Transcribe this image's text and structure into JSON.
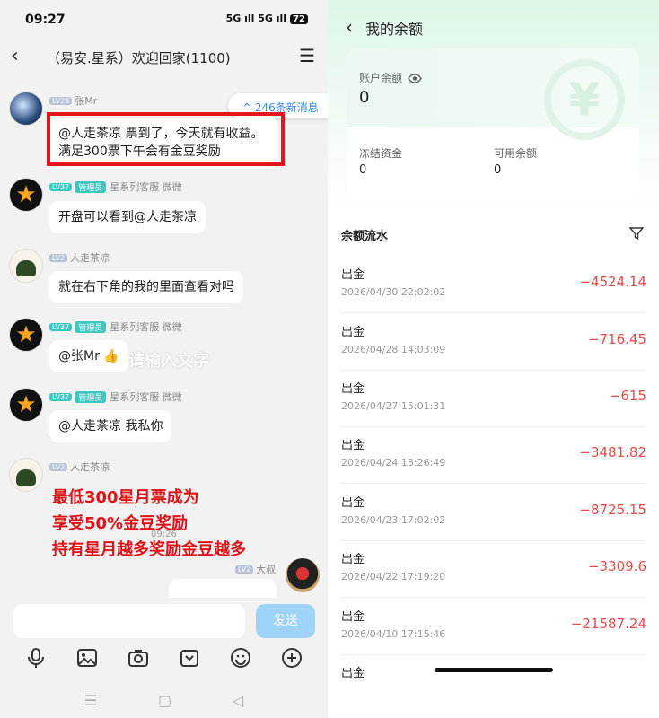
{
  "status_bar": {
    "time": "09:27",
    "signal": "5G ıll 5G ıll",
    "battery": "72"
  },
  "chat": {
    "title": "（易安.星系）欢迎回家(1100)",
    "new_messages": "^ 246条新消息",
    "messages": [
      {
        "level": "LV28",
        "sender": "张Mr",
        "text": "@人走茶凉 票到了，今天就有收益。满足300票下午会有金豆奖励"
      },
      {
        "level": "LV37",
        "role": "管理员",
        "sender": "星系列客服 微微",
        "text": "开盘可以看到@人走茶凉"
      },
      {
        "level": "LV2",
        "sender": "人走茶凉",
        "text": "就在右下角的我的里面查看对吗"
      },
      {
        "level": "LV37",
        "role": "管理员",
        "sender": "星系列客服 微微",
        "text": "@张Mr 👍"
      },
      {
        "level": "LV37",
        "role": "管理员",
        "sender": "星系列客服 微微",
        "text": "@人走茶凉 我私你"
      },
      {
        "level": "LV2",
        "sender": "人走茶凉"
      }
    ],
    "overlay_watermark": "请输入文字",
    "overlay_lines": [
      "最低300星月票成为",
      "享受50%金豆奖励",
      "持有星月越多奖励金豆越多"
    ],
    "timestamp": "09:26",
    "right_sender": {
      "level": "LV2",
      "sender": "大叔"
    },
    "send_label": "发送"
  },
  "balance": {
    "title": "我的余额",
    "account_label": "账户余额",
    "account_value": "0",
    "frozen_label": "冻结资金",
    "frozen_value": "0",
    "available_label": "可用余额",
    "available_value": "0",
    "flow_title": "余额流水",
    "rows": [
      {
        "type": "出金",
        "date": "2026/04/30 22:02:02",
        "amount": "−4524.14"
      },
      {
        "type": "出金",
        "date": "2026/04/28 14:03:09",
        "amount": "−716.45"
      },
      {
        "type": "出金",
        "date": "2026/04/27 15:01:31",
        "amount": "−615"
      },
      {
        "type": "出金",
        "date": "2026/04/24 18:26:49",
        "amount": "−3481.82"
      },
      {
        "type": "出金",
        "date": "2026/04/23 17:02:02",
        "amount": "−8725.15"
      },
      {
        "type": "出金",
        "date": "2026/04/22 17:19:20",
        "amount": "−3309.6"
      },
      {
        "type": "出金",
        "date": "2026/04/10 17:15:46",
        "amount": "−21587.24"
      },
      {
        "type": "出金"
      }
    ],
    "accent_color": "#e84a4a"
  }
}
